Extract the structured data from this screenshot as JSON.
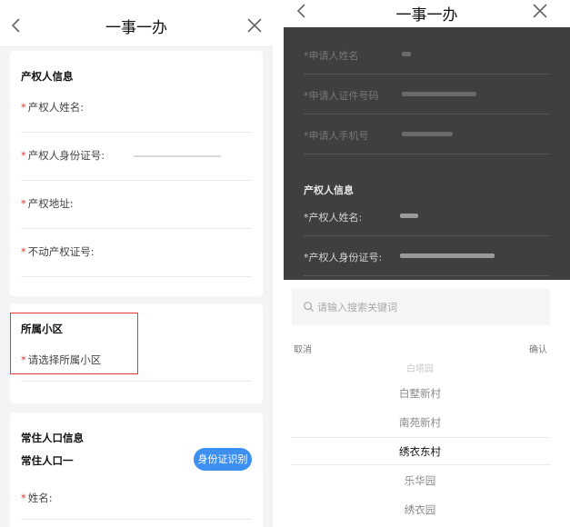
{
  "left": {
    "header": {
      "title": "一事一办"
    },
    "property_card": {
      "title": "产权人信息",
      "fields": [
        {
          "required": "*",
          "label": "产权人姓名:"
        },
        {
          "required": "*",
          "label": "产权人身份证号:"
        },
        {
          "required": "*",
          "label": "产权地址:"
        },
        {
          "required": "*",
          "label": "不动产权证号:"
        }
      ]
    },
    "community_card": {
      "title": "所属小区",
      "required": "*",
      "select_label": "请选择所属小区"
    },
    "resident_card": {
      "title": "常住人口信息",
      "subtitle": "常住人口一",
      "id_button": "身份证识别",
      "name_required": "*",
      "name_label": "姓名:"
    }
  },
  "right": {
    "header": {
      "title": "一事一办"
    },
    "background_form": {
      "applicant_fields": [
        {
          "required": "*",
          "label": "申请人姓名"
        },
        {
          "required": "*",
          "label": "申请人证件号码"
        },
        {
          "required": "*",
          "label": "申请人手机号"
        }
      ],
      "section_title": "产权人信息",
      "owner_fields": [
        {
          "required": "*",
          "label": "产权人姓名:"
        },
        {
          "required": "*",
          "label": "产权人身份证号:"
        }
      ]
    },
    "picker": {
      "search_placeholder": "请输入搜索关键词",
      "cancel": "取消",
      "confirm": "确认",
      "options": [
        "白塔园",
        "白墅新村",
        "南苑新村",
        "绣衣东村",
        "乐华园",
        "绣衣园"
      ],
      "selected": "绣衣东村"
    }
  },
  "colors": {
    "required_mark": "#e53935",
    "highlight_border": "#e53935",
    "id_button_bg": "#3d8ff0",
    "overlay_bg": "#3f3f3f"
  }
}
